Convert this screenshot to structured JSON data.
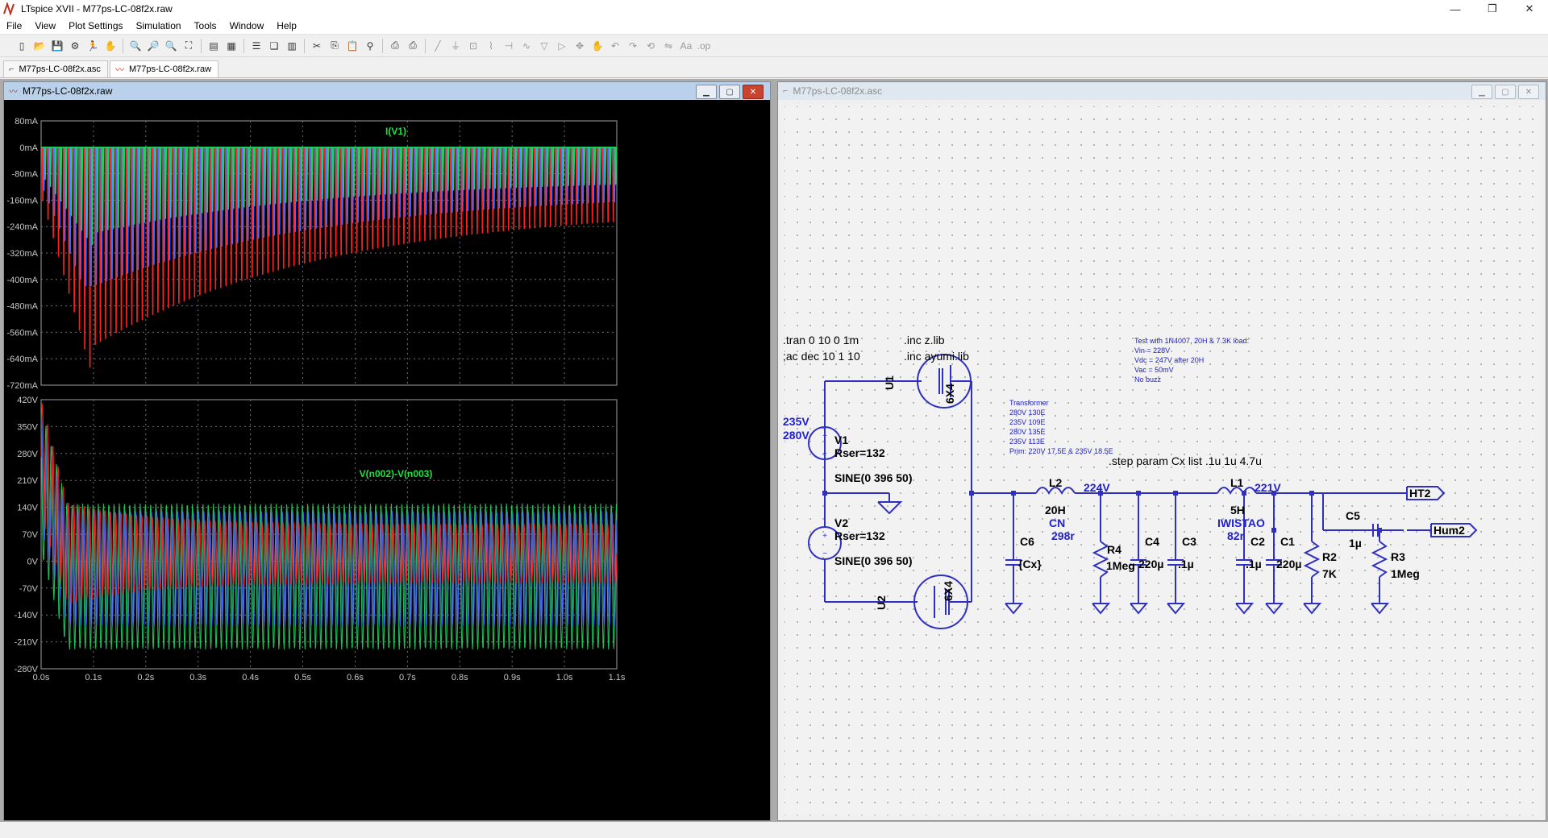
{
  "window": {
    "title": "LTspice XVII - M77ps-LC-08f2x.raw"
  },
  "menu": [
    "File",
    "View",
    "Plot Settings",
    "Simulation",
    "Tools",
    "Window",
    "Help"
  ],
  "doc_tabs": [
    {
      "label": "M77ps-LC-08f2x.asc",
      "active": false
    },
    {
      "label": "M77ps-LC-08f2x.raw",
      "active": true
    }
  ],
  "waveform_window": {
    "title": "M77ps-LC-08f2x.raw",
    "chart_data": [
      {
        "type": "line",
        "title": "I(V1)",
        "y_ticks": [
          "80mA",
          "0mA",
          "-80mA",
          "-160mA",
          "-240mA",
          "-320mA",
          "-400mA",
          "-480mA",
          "-560mA",
          "-640mA",
          "-720mA"
        ],
        "ylim": [
          -720,
          80
        ],
        "yunit": "mA",
        "grid": true,
        "colors": [
          "#ff2020",
          "#4a6cff",
          "#20d060"
        ]
      },
      {
        "type": "line",
        "title": "V(n002)-V(n003)",
        "y_ticks": [
          "420V",
          "350V",
          "280V",
          "210V",
          "140V",
          "70V",
          "0V",
          "-70V",
          "-140V",
          "-210V",
          "-280V"
        ],
        "x_ticks": [
          "0.0s",
          "0.1s",
          "0.2s",
          "0.3s",
          "0.4s",
          "0.5s",
          "0.6s",
          "0.7s",
          "0.8s",
          "0.9s",
          "1.0s",
          "1.1s"
        ],
        "xlim": [
          0,
          1.1
        ],
        "ylim": [
          -280,
          420
        ],
        "yunit": "V",
        "grid": true,
        "colors": [
          "#ff2020",
          "#4a6cff",
          "#20d060"
        ]
      }
    ]
  },
  "schematic_window": {
    "title": "M77ps-LC-08f2x.asc",
    "directives": {
      "tran": ".tran 0 10 0 1m",
      "ac": ";ac dec 10 1 10",
      "inc1": ".inc z.lib",
      "inc2": ".inc ayumi.lib",
      "step": ".step param Cx list .1u 1u 4.7u"
    },
    "note1": [
      "Test with 1N4007, 20H & 7.3K load:",
      "Vin = 228V",
      "Vdc = 247V after 20H",
      "Vac = 50mV",
      "No buzz"
    ],
    "note2": [
      "Transformer",
      "280V 130E",
      "235V 109E",
      "280V 135E",
      "235V 113E",
      "Prim: 220V 17.5E & 235V 18.5E"
    ],
    "labels": {
      "v235": "235V",
      "v280": "280V",
      "v224": "224V",
      "v221": "221V",
      "V1": "V1",
      "V2": "V2",
      "rser": "Rser=132",
      "sine": "SINE(0 396 50)",
      "U1": "U1",
      "U2": "U2",
      "tube": "6X4",
      "L2": "L2",
      "L2v": "20H",
      "L2n": "CN",
      "L2r": "298r",
      "L1": "L1",
      "L1v": "5H",
      "L1n": "IWISTAO",
      "L1r": "82r",
      "C6": "C6",
      "C6v": "{Cx}",
      "R4": "R4",
      "R4v": "1Meg",
      "C4": "C4",
      "C4v": "220µ",
      "C3": "C3",
      "C3v": ".1µ",
      "C2": "C2",
      "C2v": ".1µ",
      "C1": "C1",
      "C1v": "220µ",
      "R2": "R2",
      "R2v": "7K",
      "C5": "C5",
      "C5v": "1µ",
      "R3": "R3",
      "R3v": "1Meg",
      "HT2": "HT2",
      "Hum2": "Hum2"
    }
  }
}
